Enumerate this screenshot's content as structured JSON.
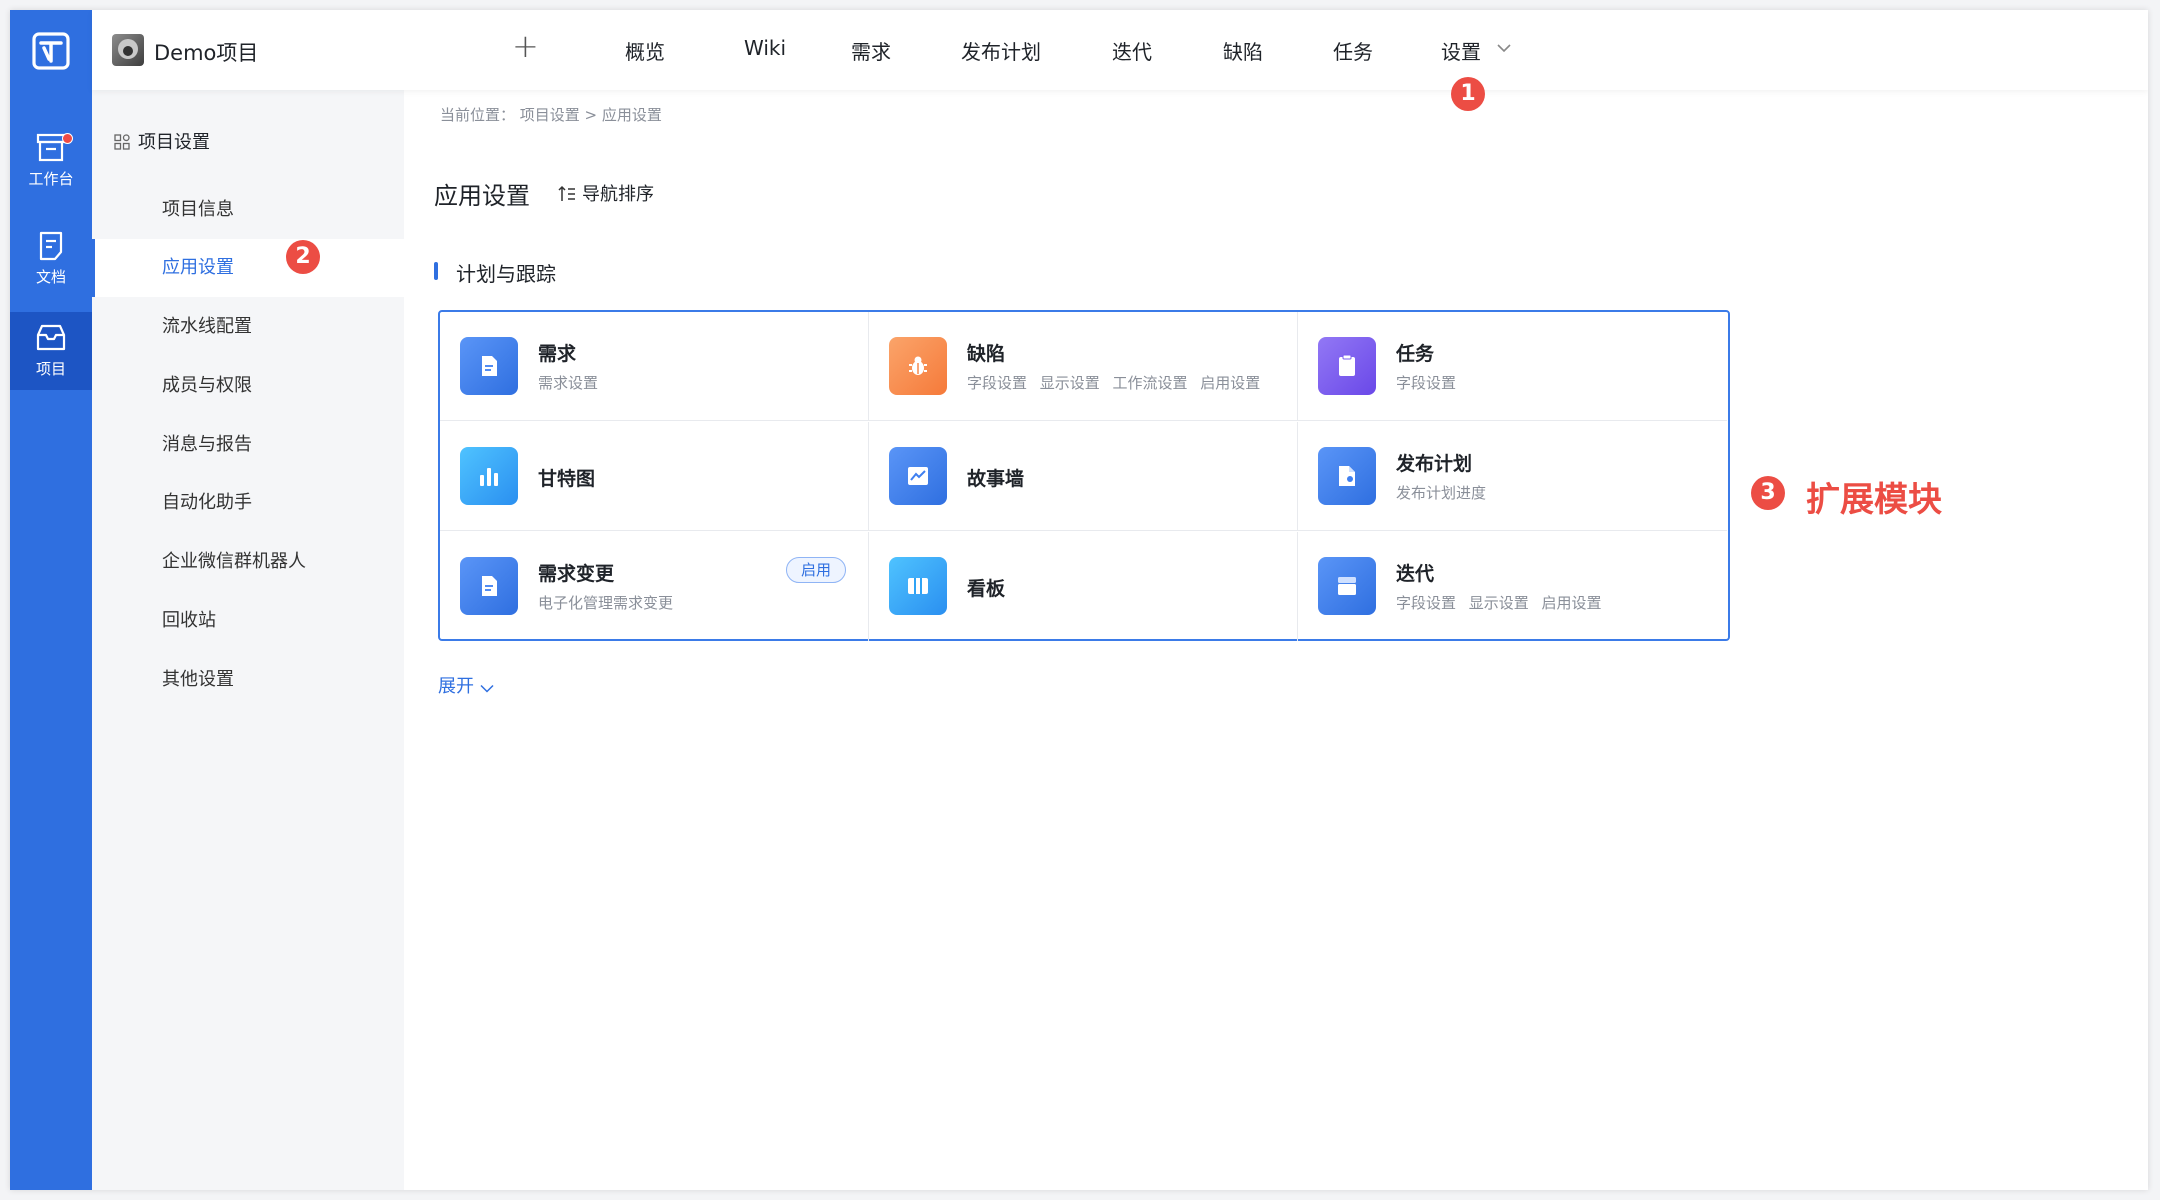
{
  "header": {
    "project_name": "Demo项目",
    "nav": [
      "概览",
      "Wiki",
      "需求",
      "发布计划",
      "迭代",
      "缺陷",
      "任务",
      "设置"
    ]
  },
  "rail": {
    "items": [
      {
        "label": "工作台",
        "icon": "inbox-box-icon"
      },
      {
        "label": "文档",
        "icon": "document-icon"
      },
      {
        "label": "项目",
        "icon": "folder-icon"
      }
    ]
  },
  "sidebar": {
    "heading": "项目设置",
    "items": [
      "项目信息",
      "应用设置",
      "流水线配置",
      "成员与权限",
      "消息与报告",
      "自动化助手",
      "企业微信群机器人",
      "回收站",
      "其他设置"
    ],
    "active": "应用设置"
  },
  "main": {
    "breadcrumb": "当前位置： 项目设置 > 应用设置",
    "title": "应用设置",
    "sort_label": "导航排序",
    "section_title": "计划与跟踪",
    "expand_label": "展开"
  },
  "modules": [
    {
      "title": "需求",
      "sub": "需求设置",
      "icon": "document-icon",
      "color": "#3f7ff0"
    },
    {
      "title": "缺陷",
      "sub": "字段设置 显示设置 工作流设置 启用设置",
      "icon": "bug-icon",
      "color": "#f7894a"
    },
    {
      "title": "任务",
      "sub": "字段设置",
      "icon": "task-icon",
      "color": "#7a5cf0"
    },
    {
      "title": "甘特图",
      "sub": "",
      "icon": "bar-chart-icon",
      "color": "#2fa3f5"
    },
    {
      "title": "故事墙",
      "sub": "",
      "icon": "story-wall-icon",
      "color": "#3f7ff0"
    },
    {
      "title": "发布计划",
      "sub": "发布计划进度",
      "icon": "release-icon",
      "color": "#3f7ff0"
    },
    {
      "title": "需求变更",
      "sub": "电子化管理需求变更",
      "icon": "document-icon",
      "color": "#3f7ff0",
      "tag": "启用"
    },
    {
      "title": "看板",
      "sub": "",
      "icon": "kanban-icon",
      "color": "#2fa3f5"
    },
    {
      "title": "迭代",
      "sub": "字段设置 显示设置 启用设置",
      "icon": "iteration-icon",
      "color": "#3f7ff0"
    }
  ],
  "annotations": {
    "step1": "1",
    "step2": "2",
    "step3": "3",
    "step3_label": "扩展模块",
    "color": "#ec4d44"
  }
}
